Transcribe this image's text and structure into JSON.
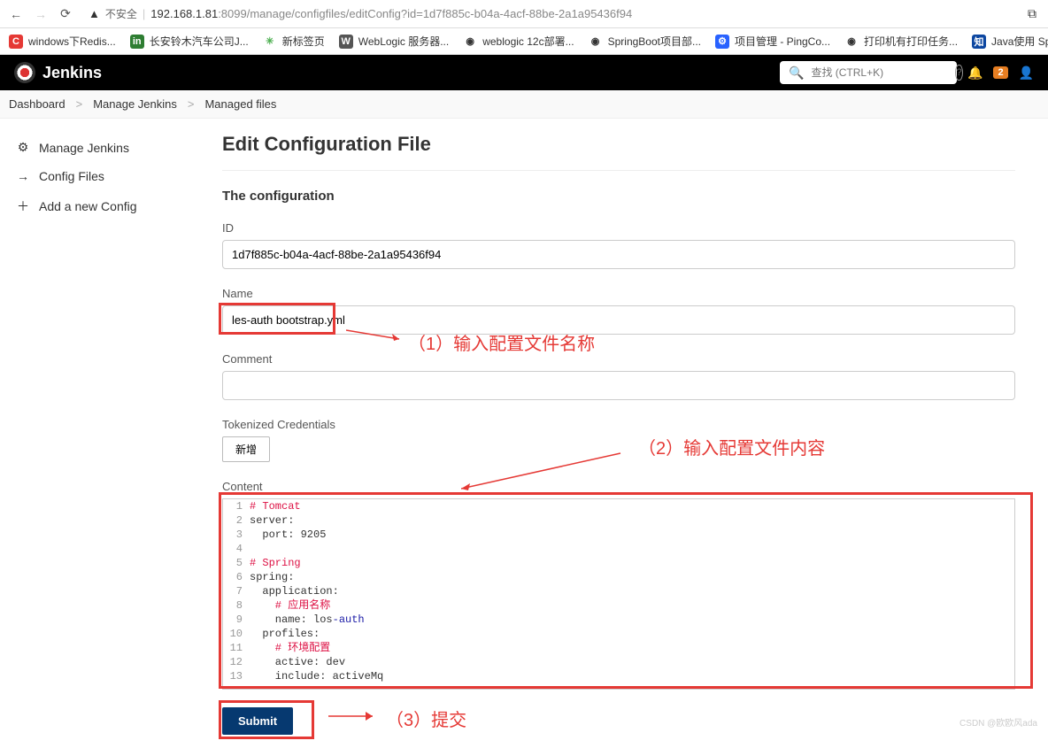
{
  "browser": {
    "security": "不安全",
    "url_host": "192.168.1.81",
    "url_rest": ":8099/manage/configfiles/editConfig?id=1d7f885c-b04a-4acf-88be-2a1a95436f94"
  },
  "bookmarks": [
    {
      "icon": "C",
      "bg": "#e53935",
      "fg": "#fff",
      "label": "windows下Redis..."
    },
    {
      "icon": "in",
      "bg": "#2e7d32",
      "fg": "#fff",
      "label": "长安铃木汽车公司J..."
    },
    {
      "icon": "✳",
      "bg": "",
      "fg": "#4caf50",
      "label": "新标签页"
    },
    {
      "icon": "W",
      "bg": "#555",
      "fg": "#fff",
      "label": "WebLogic 服务器..."
    },
    {
      "icon": "◉",
      "bg": "",
      "fg": "#333",
      "label": "weblogic 12c部署..."
    },
    {
      "icon": "◉",
      "bg": "",
      "fg": "#333",
      "label": "SpringBoot项目部..."
    },
    {
      "icon": "⚙",
      "bg": "#2962ff",
      "fg": "#fff",
      "label": "项目管理 - PingCo..."
    },
    {
      "icon": "◉",
      "bg": "",
      "fg": "#333",
      "label": "打印机有打印任务..."
    },
    {
      "icon": "知",
      "bg": "#0d47a1",
      "fg": "#fff",
      "label": "Java使用 Springbo..."
    }
  ],
  "header": {
    "logo": "Jenkins",
    "search_placeholder": "查找 (CTRL+K)",
    "notif_count": "2"
  },
  "breadcrumb": [
    "Dashboard",
    "Manage Jenkins",
    "Managed files"
  ],
  "sidebar": [
    {
      "icon": "gear",
      "label": "Manage Jenkins"
    },
    {
      "icon": "arrow",
      "label": "Config Files"
    },
    {
      "icon": "plus",
      "label": "Add a new Config"
    }
  ],
  "page": {
    "title": "Edit Configuration File",
    "subtitle": "The configuration",
    "labels": {
      "id": "ID",
      "name": "Name",
      "comment": "Comment",
      "tokenized": "Tokenized Credentials",
      "add_btn": "新增",
      "content": "Content",
      "submit": "Submit"
    },
    "values": {
      "id": "1d7f885c-b04a-4acf-88be-2a1a95436f94",
      "name": "les-auth bootstrap.yml",
      "comment": ""
    }
  },
  "code_lines": [
    {
      "n": 1,
      "t": "comment",
      "text": "# Tomcat"
    },
    {
      "n": 2,
      "t": "key",
      "text": "server:"
    },
    {
      "n": 3,
      "t": "kv",
      "text": "  port: 9205"
    },
    {
      "n": 4,
      "t": "",
      "text": ""
    },
    {
      "n": 5,
      "t": "comment",
      "text": "# Spring"
    },
    {
      "n": 6,
      "t": "key",
      "text": "spring:"
    },
    {
      "n": 7,
      "t": "key",
      "text": "  application:"
    },
    {
      "n": 8,
      "t": "comment",
      "text": "    # 应用名称"
    },
    {
      "n": 9,
      "t": "kv2",
      "text": "    name: los-auth"
    },
    {
      "n": 10,
      "t": "key",
      "text": "  profiles:"
    },
    {
      "n": 11,
      "t": "comment",
      "text": "    # 环境配置"
    },
    {
      "n": 12,
      "t": "kv",
      "text": "    active: dev"
    },
    {
      "n": 13,
      "t": "kv",
      "text": "    include: activeMq"
    }
  ],
  "annotations": {
    "a1": "（1）输入配置文件名称",
    "a2": "（2）输入配置文件内容",
    "a3": "（3）提交"
  },
  "watermark": "CSDN @欧欧风ada"
}
